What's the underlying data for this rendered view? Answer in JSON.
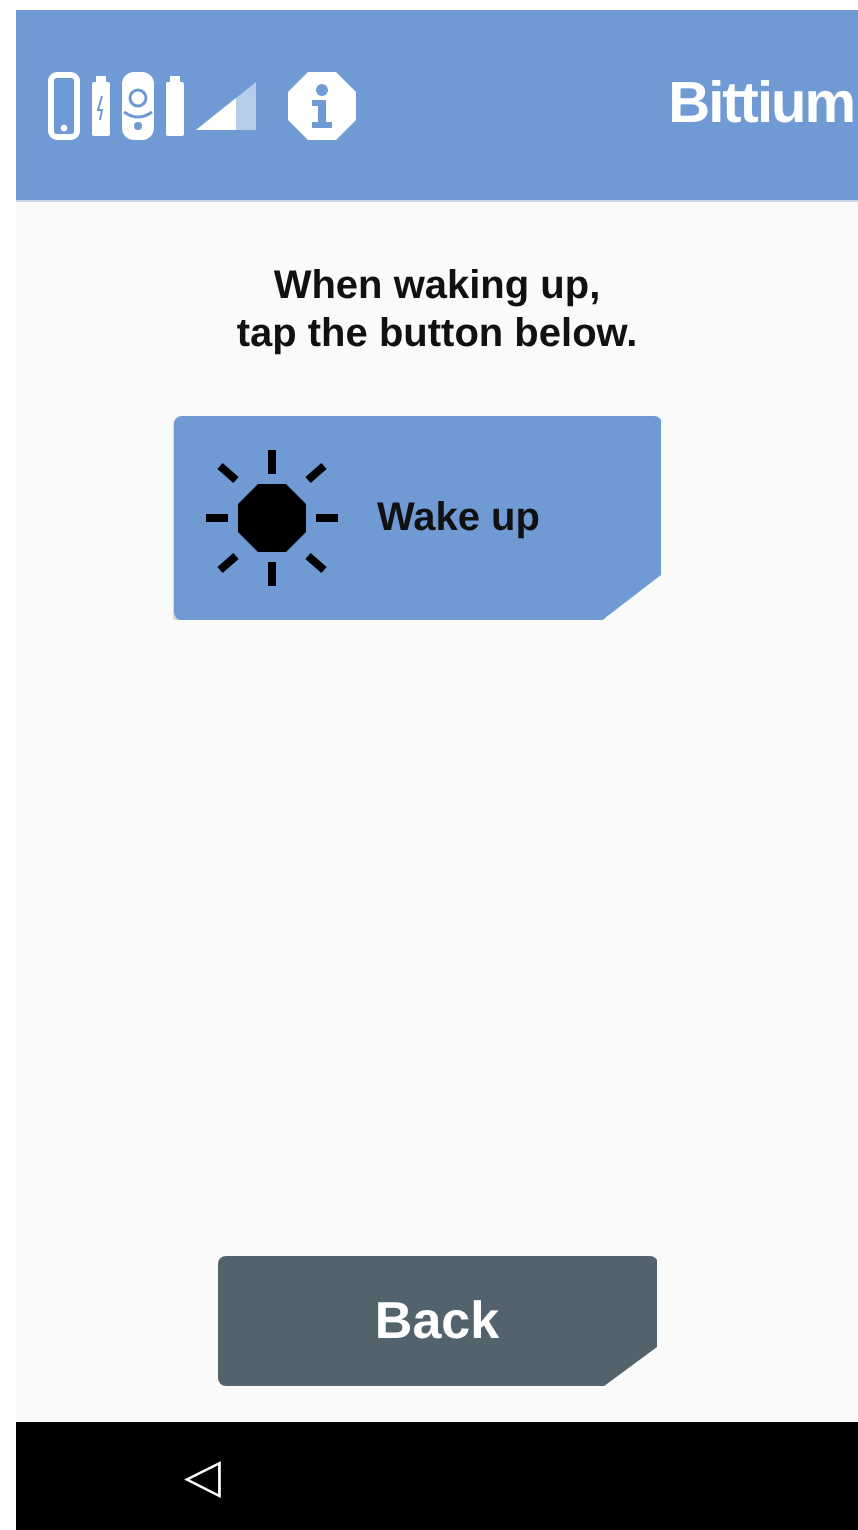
{
  "header": {
    "brand": "Bittium"
  },
  "instruction": "When waking up,\ntap the button below.",
  "wake_button": {
    "label": "Wake up"
  },
  "back_button": {
    "label": "Back"
  },
  "nav_bar": {
    "back_symbol": "◁"
  }
}
